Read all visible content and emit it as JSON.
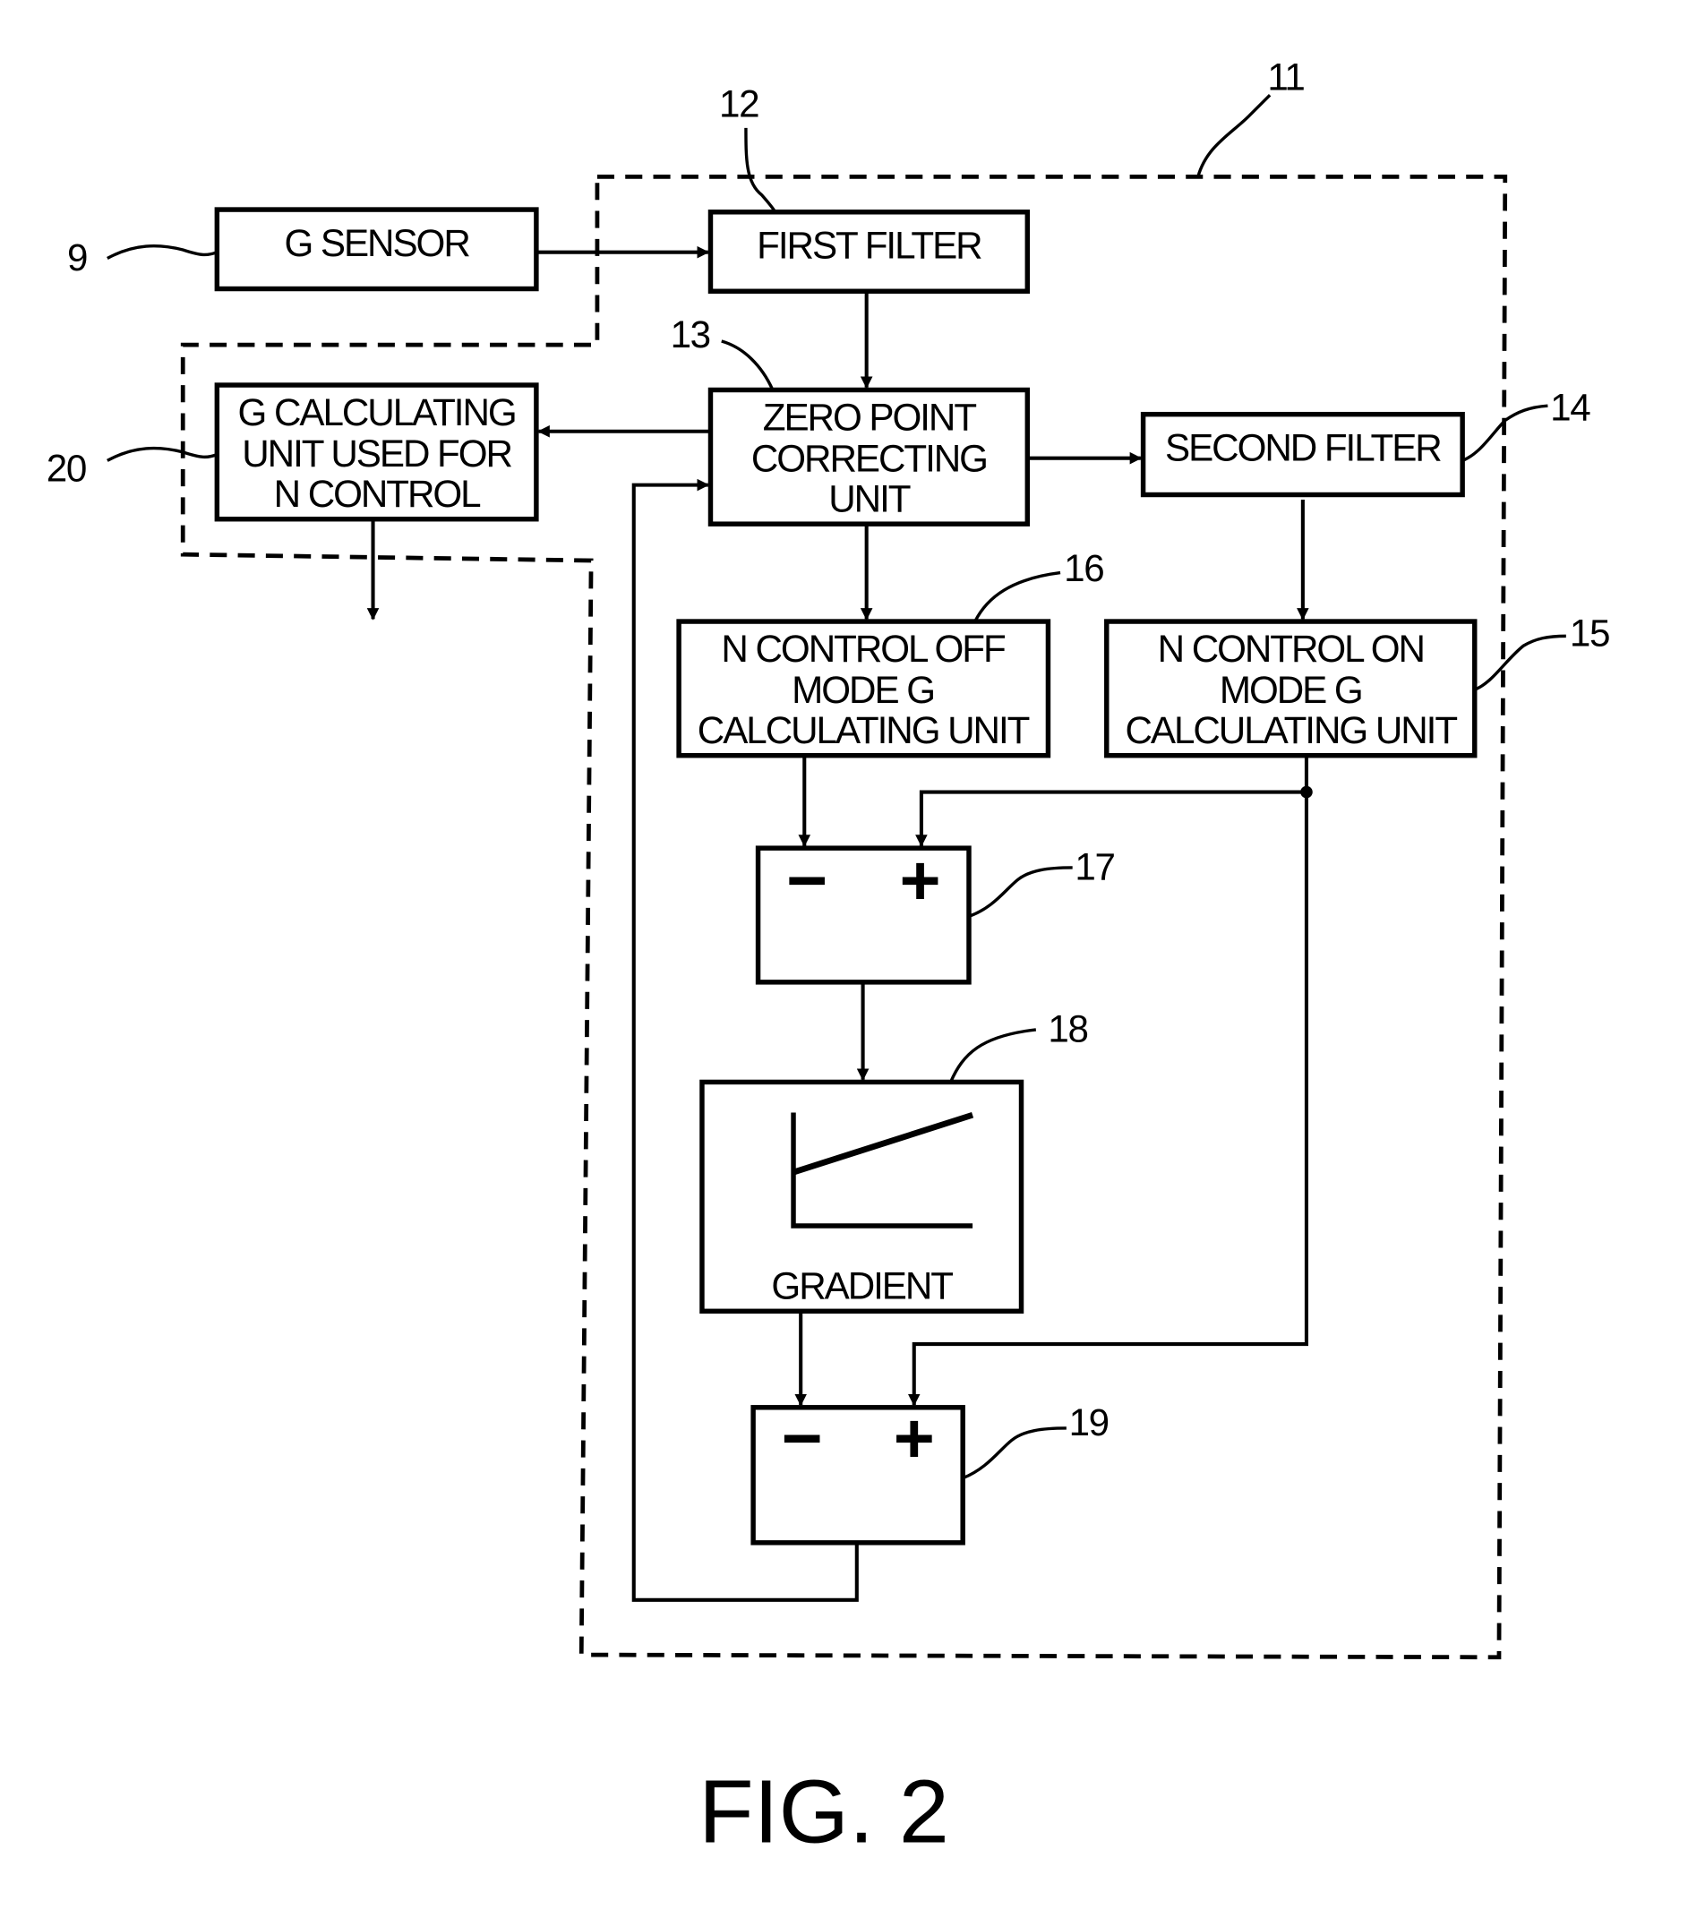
{
  "figure": {
    "caption": "FIG. 2",
    "blocks": {
      "g_sensor": {
        "ref": "9",
        "lines": [
          "G SENSOR"
        ]
      },
      "first_filter": {
        "ref": "12",
        "lines": [
          "FIRST FILTER"
        ]
      },
      "zero_point": {
        "ref": "13",
        "lines": [
          "ZERO POINT",
          "CORRECTING",
          "UNIT"
        ]
      },
      "g_calc_n": {
        "ref": "20",
        "lines": [
          "G CALCULATING",
          "UNIT USED FOR",
          "N CONTROL"
        ]
      },
      "second_filter": {
        "ref": "14",
        "lines": [
          "SECOND FILTER"
        ]
      },
      "n_off": {
        "ref": "16",
        "lines": [
          "N CONTROL OFF",
          "MODE G",
          "CALCULATING UNIT"
        ]
      },
      "n_on": {
        "ref": "15",
        "lines": [
          "N CONTROL ON",
          "MODE G",
          "CALCULATING UNIT"
        ]
      },
      "sub1": {
        "ref": "17",
        "minus": "−",
        "plus": "+"
      },
      "gradient": {
        "ref": "18",
        "label": "GRADIENT"
      },
      "sub2": {
        "ref": "19",
        "minus": "−",
        "plus": "+"
      }
    },
    "enclosure": {
      "ref": "11"
    }
  }
}
